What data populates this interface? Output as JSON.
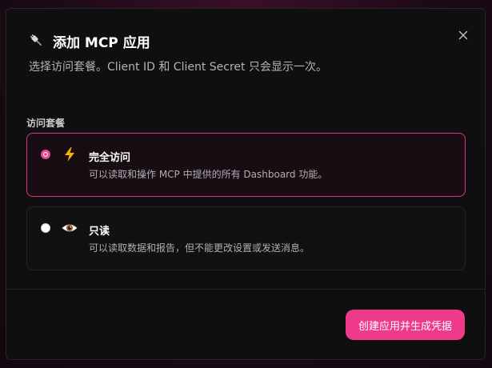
{
  "dialog": {
    "title": "添加 MCP 应用",
    "subtitle": "选择访问套餐。Client ID 和 Client Secret 只会显示一次。",
    "title_icon": "plug-icon",
    "close_icon": "close-icon"
  },
  "plans": {
    "section_label": "访问套餐",
    "options": [
      {
        "title": "完全访问",
        "description": "可以读取和操作 MCP 中提供的所有 Dashboard 功能。",
        "icon": "lightning-icon",
        "selected": true
      },
      {
        "title": "只读",
        "description": "可以读取数据和报告，但不能更改设置或发送消息。",
        "icon": "eye-icon",
        "selected": false
      }
    ]
  },
  "footer": {
    "submit_label": "创建应用并生成凭据"
  },
  "colors": {
    "accent": "#ef3a8c",
    "selected_border": "#e0338b",
    "background": "#0f0f10"
  }
}
